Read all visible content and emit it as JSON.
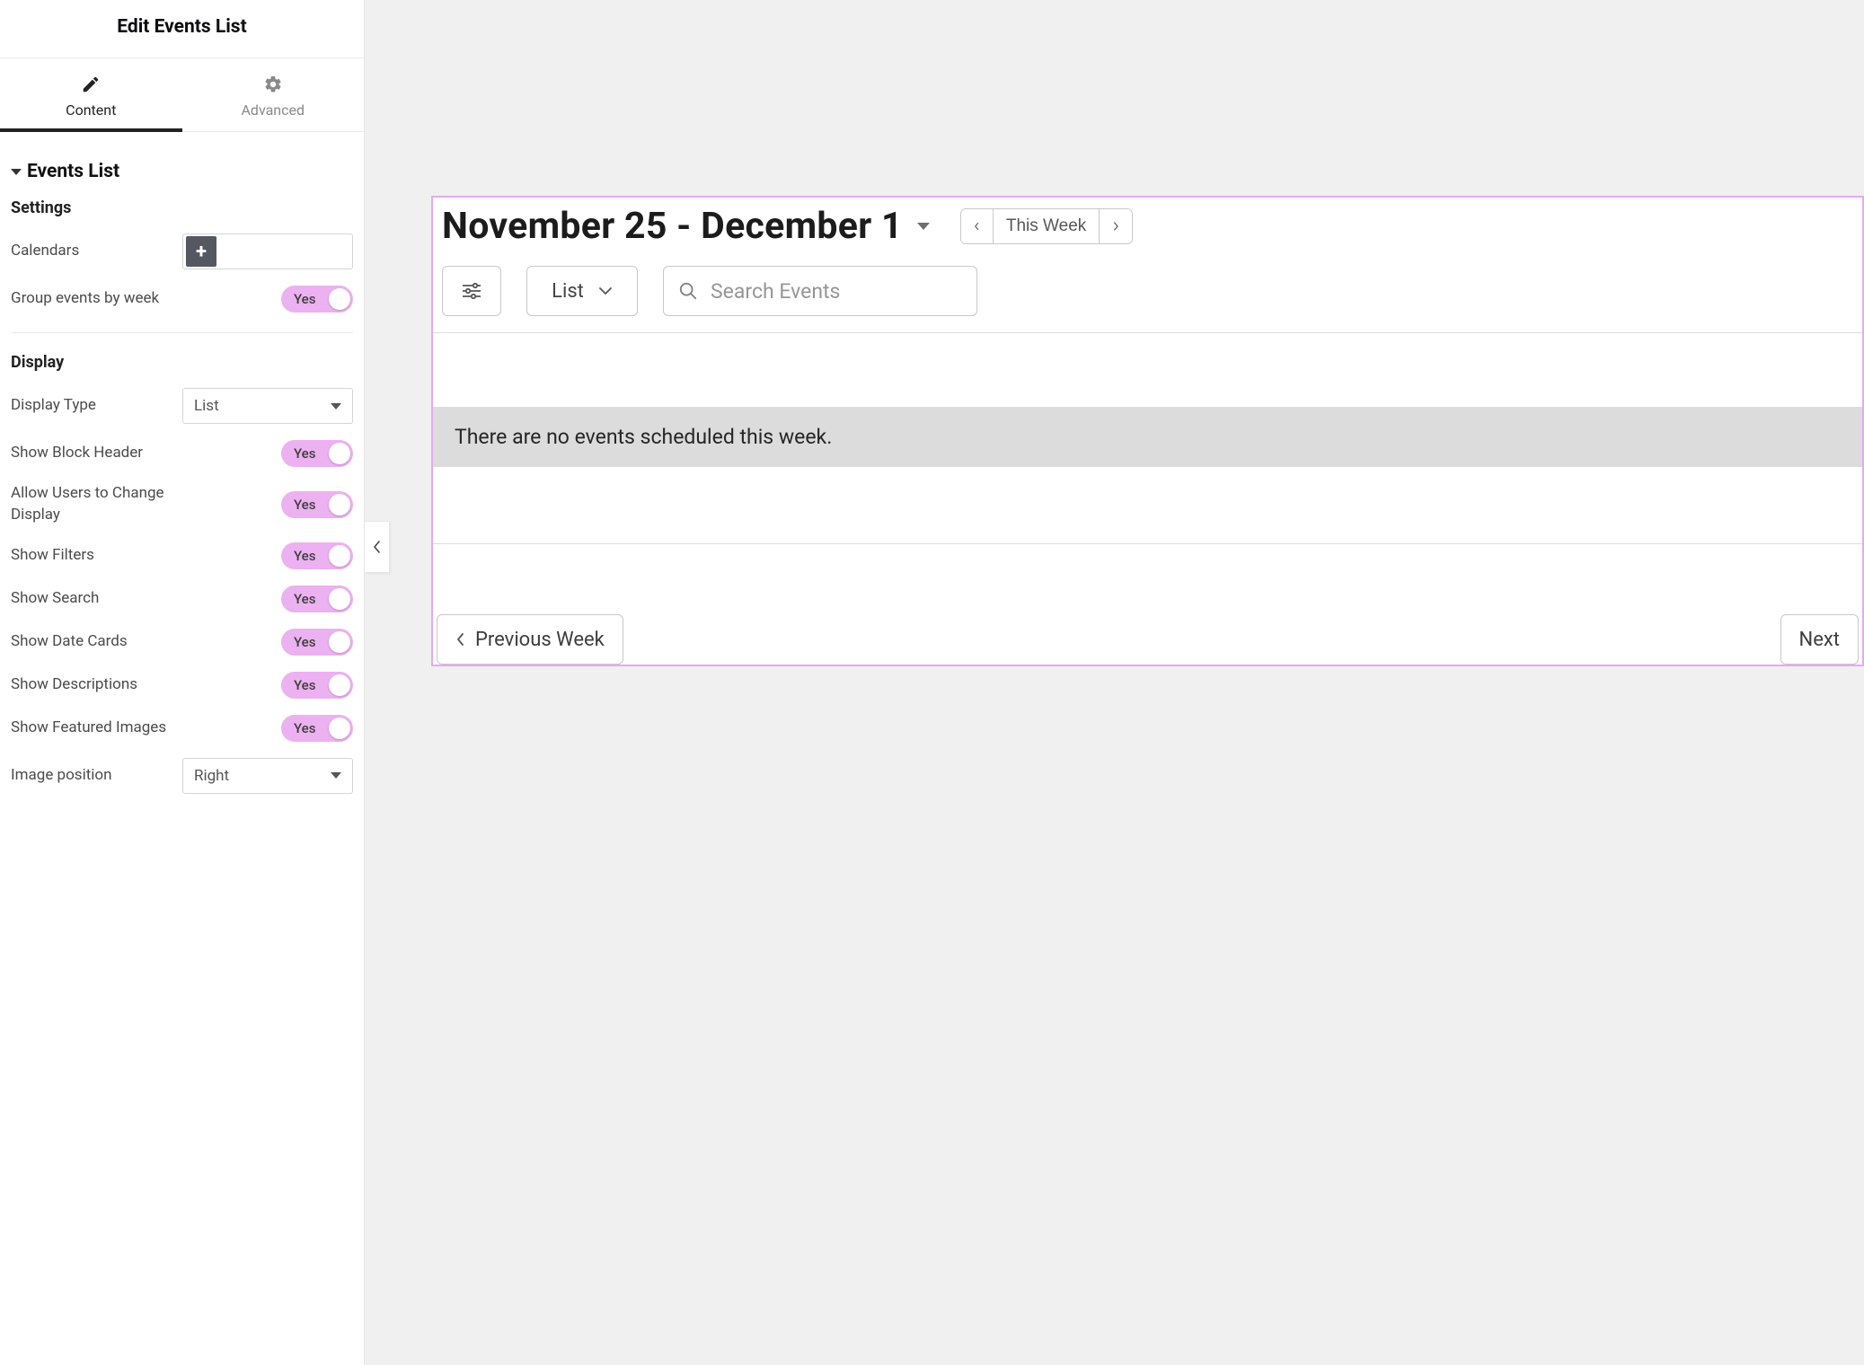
{
  "sidebar": {
    "title": "Edit Events List",
    "tabs": {
      "content": "Content",
      "advanced": "Advanced"
    },
    "section_title": "Events List",
    "settings_title": "Settings",
    "calendars_label": "Calendars",
    "group_by_week_label": "Group events by week",
    "display_title": "Display",
    "display_type_label": "Display Type",
    "display_type_value": "List",
    "image_position_label": "Image position",
    "image_position_value": "Right",
    "toggles": {
      "group_by_week": "Yes",
      "show_block_header_label": "Show Block Header",
      "show_block_header": "Yes",
      "allow_change_display_label": "Allow Users to Change Display",
      "allow_change_display": "Yes",
      "show_filters_label": "Show Filters",
      "show_filters": "Yes",
      "show_search_label": "Show Search",
      "show_search": "Yes",
      "show_date_cards_label": "Show Date Cards",
      "show_date_cards": "Yes",
      "show_descriptions_label": "Show Descriptions",
      "show_descriptions": "Yes",
      "show_featured_images_label": "Show Featured Images",
      "show_featured_images": "Yes"
    }
  },
  "preview": {
    "date_range": "November 25 - December 1",
    "this_week": "This Week",
    "view_mode": "List",
    "search_placeholder": "Search Events",
    "empty_message": "There are no events scheduled this week.",
    "prev_week": "Previous Week",
    "next_week": "Next"
  }
}
